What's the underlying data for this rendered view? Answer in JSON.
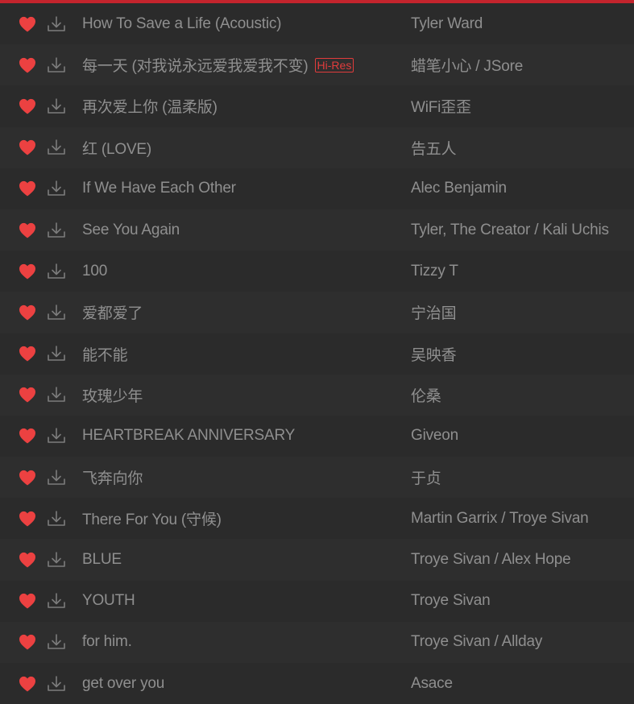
{
  "colors": {
    "accent": "#c3242d",
    "heart": "#ec4141",
    "text": "#8f8f8f",
    "row_odd": "#2b2b2b",
    "row_even": "#2e2e2e"
  },
  "icons": {
    "like": "heart-icon",
    "download": "download-icon"
  },
  "tracks": [
    {
      "title": "How To Save a Life (Acoustic)",
      "artist": "Tyler Ward",
      "badge": ""
    },
    {
      "title": "每一天 (对我说永远爱我爱我不变)",
      "artist": "蜡笔小心 / JSore",
      "badge": "Hi-Res"
    },
    {
      "title": "再次爱上你 (温柔版)",
      "artist": "WiFi歪歪",
      "badge": ""
    },
    {
      "title": "红 (LOVE)",
      "artist": "告五人",
      "badge": ""
    },
    {
      "title": "If We Have Each Other",
      "artist": "Alec Benjamin",
      "badge": ""
    },
    {
      "title": "See You Again",
      "artist": "Tyler, The Creator / Kali Uchis",
      "badge": ""
    },
    {
      "title": "100",
      "artist": "Tizzy T",
      "badge": ""
    },
    {
      "title": "爱都爱了",
      "artist": "宁治国",
      "badge": ""
    },
    {
      "title": "能不能",
      "artist": "吴映香",
      "badge": ""
    },
    {
      "title": "玫瑰少年",
      "artist": "伦桑",
      "badge": ""
    },
    {
      "title": "HEARTBREAK ANNIVERSARY",
      "artist": "Giveon",
      "badge": ""
    },
    {
      "title": "飞奔向你",
      "artist": "于贞",
      "badge": ""
    },
    {
      "title": "There For You (守候)",
      "artist": "Martin Garrix / Troye Sivan",
      "badge": ""
    },
    {
      "title": "BLUE",
      "artist": "Troye Sivan / Alex Hope",
      "badge": ""
    },
    {
      "title": "YOUTH",
      "artist": "Troye Sivan",
      "badge": ""
    },
    {
      "title": "for him.",
      "artist": "Troye Sivan / Allday",
      "badge": ""
    },
    {
      "title": "get over you",
      "artist": "Asace",
      "badge": ""
    }
  ]
}
